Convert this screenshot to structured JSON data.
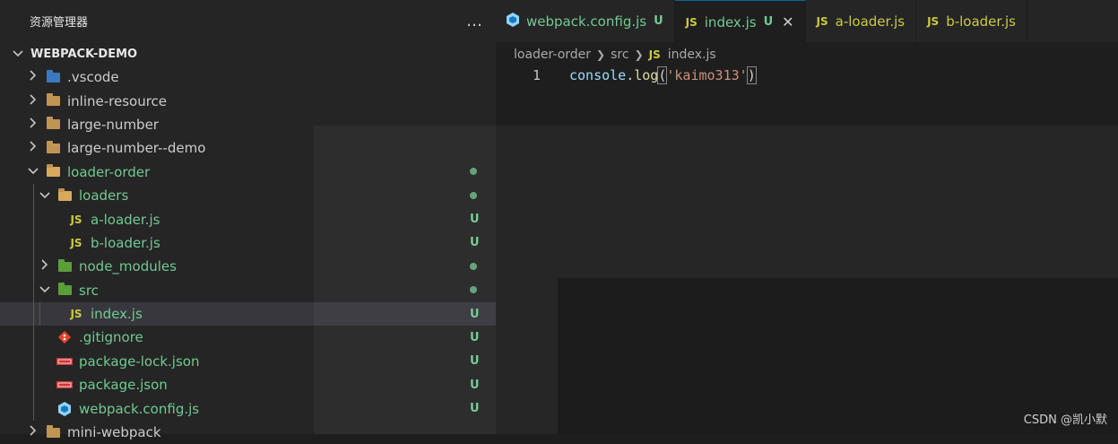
{
  "explorer": {
    "title": "资源管理器",
    "more_icon": "…",
    "project": "WEBPACK-DEMO"
  },
  "tree": [
    {
      "label": ".vscode",
      "type": "folder",
      "color": "blue",
      "depth": 0,
      "expanded": false,
      "text_color": "#cccccc",
      "badge": ""
    },
    {
      "label": "inline-resource",
      "type": "folder",
      "color": "default",
      "depth": 0,
      "expanded": false,
      "text_color": "#cccccc",
      "badge": ""
    },
    {
      "label": "large-number",
      "type": "folder",
      "color": "default",
      "depth": 0,
      "expanded": false,
      "text_color": "#cccccc",
      "badge": ""
    },
    {
      "label": "large-number--demo",
      "type": "folder",
      "color": "default",
      "depth": 0,
      "expanded": false,
      "text_color": "#cccccc",
      "badge": ""
    },
    {
      "label": "loader-order",
      "type": "folder",
      "color": "open",
      "depth": 0,
      "expanded": true,
      "text_color": "#73c991",
      "badge": "dot"
    },
    {
      "label": "loaders",
      "type": "folder",
      "color": "open",
      "depth": 1,
      "expanded": true,
      "text_color": "#73c991",
      "badge": "dot"
    },
    {
      "label": "a-loader.js",
      "type": "js",
      "depth": 2,
      "text_color": "#73c991",
      "badge": "U"
    },
    {
      "label": "b-loader.js",
      "type": "js",
      "depth": 2,
      "text_color": "#73c991",
      "badge": "U"
    },
    {
      "label": "node_modules",
      "type": "folder",
      "color": "green",
      "depth": 1,
      "expanded": false,
      "text_color": "#73c991",
      "badge": "dot"
    },
    {
      "label": "src",
      "type": "folder",
      "color": "green",
      "depth": 1,
      "expanded": true,
      "text_color": "#73c991",
      "badge": "dot"
    },
    {
      "label": "index.js",
      "type": "js",
      "depth": 2,
      "text_color": "#73c991",
      "badge": "U",
      "selected": true
    },
    {
      "label": ".gitignore",
      "type": "git",
      "depth": 1,
      "text_color": "#73c991",
      "badge": "U"
    },
    {
      "label": "package-lock.json",
      "type": "npm",
      "depth": 1,
      "text_color": "#73c991",
      "badge": "U"
    },
    {
      "label": "package.json",
      "type": "npm",
      "depth": 1,
      "text_color": "#73c991",
      "badge": "U"
    },
    {
      "label": "webpack.config.js",
      "type": "webpack",
      "depth": 1,
      "text_color": "#73c991",
      "badge": "U"
    },
    {
      "label": "mini-webpack",
      "type": "folder",
      "color": "default",
      "depth": 0,
      "expanded": false,
      "text_color": "#cccccc",
      "badge": ""
    }
  ],
  "tabs": [
    {
      "label": "webpack.config.js",
      "icon": "webpack",
      "git": "U",
      "active": false
    },
    {
      "label": "index.js",
      "icon": "JS",
      "git": "U",
      "active": true,
      "close": "✕"
    },
    {
      "label": "a-loader.js",
      "icon": "JS",
      "git": "",
      "active": false
    },
    {
      "label": "b-loader.js",
      "icon": "JS",
      "git": "",
      "active": false
    }
  ],
  "breadcrumb": {
    "parts": [
      "loader-order",
      "src"
    ],
    "file_icon": "JS",
    "file": "index.js"
  },
  "code": {
    "line_number": "1",
    "object": "console",
    "dot": ".",
    "method": "log",
    "open_paren": "(",
    "string": "'kaimo313'",
    "close_paren": ")"
  },
  "watermark": "CSDN @凯小默",
  "colors": {
    "git_untracked": "#73c991",
    "js_icon": "#cbcb41",
    "selection": "#37373d",
    "accent": "#0e639c"
  }
}
